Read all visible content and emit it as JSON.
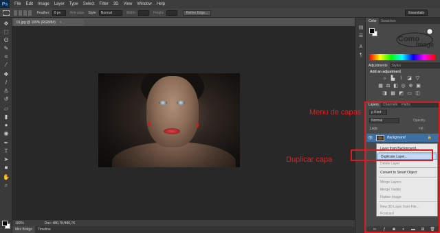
{
  "menubar": {
    "logo": "Ps",
    "items": [
      "File",
      "Edit",
      "Image",
      "Layer",
      "Type",
      "Select",
      "Filter",
      "3D",
      "View",
      "Window",
      "Help"
    ]
  },
  "options_bar": {
    "feather_label": "Feather:",
    "feather_value": "0 px",
    "antialias_label": "Anti-alias",
    "style_label": "Style:",
    "style_value": "Normal",
    "width_label": "Width:",
    "height_label": "Height:",
    "refine_edge_label": "Refine Edge...",
    "workspace_value": "Essentials"
  },
  "document": {
    "tab_title": "01.jpg @ 100% (RGB/8#)",
    "close_glyph": "×",
    "zoom": "100%",
    "doc_size": "Doc: 480,7K/480,7K"
  },
  "bottom_tabs": [
    "Mini Bridge",
    "Timeline"
  ],
  "color_panel": {
    "tabs": [
      "Color",
      "Swatches"
    ]
  },
  "adjustments_panel": {
    "tabs": [
      "Adjustments",
      "Styles"
    ],
    "title": "Add an adjustment"
  },
  "layers_panel": {
    "tabs": [
      "Layers",
      "Channels",
      "Paths"
    ],
    "kind_label": "ρ Kind",
    "blend_mode": "Normal",
    "opacity_label": "Opacity:",
    "lock_label": "Lock:",
    "fill_label": "Fill:",
    "layer_name": "Background"
  },
  "context_menu": {
    "items": [
      {
        "label": "Layer from Background...",
        "state": "normal"
      },
      {
        "label": "Duplicate Layer...",
        "state": "highlight"
      },
      {
        "label": "Delete Layer",
        "state": "disabled"
      },
      {
        "label": "Convert to Smart Object",
        "state": "normal"
      },
      {
        "label": "Merge Layers",
        "state": "disabled"
      },
      {
        "label": "Merge Visible",
        "state": "disabled"
      },
      {
        "label": "Flatten Image",
        "state": "disabled"
      },
      {
        "label": "New 3D Layer from File...",
        "state": "disabled"
      },
      {
        "label": "Postcard",
        "state": "disabled"
      }
    ]
  },
  "annotations": {
    "menu_label": "Menu de capas",
    "duplicate_label": "Duplicar capa",
    "color": "#e02020"
  },
  "icons": {
    "tools": [
      "move-icon",
      "marquee-icon",
      "lasso-icon",
      "quick-select-icon",
      "crop-icon",
      "eyedropper-icon",
      "healing-brush-icon",
      "brush-icon",
      "clone-stamp-icon",
      "history-brush-icon",
      "eraser-icon",
      "gradient-icon",
      "blur-icon",
      "dodge-icon",
      "pen-icon",
      "type-icon",
      "path-select-icon",
      "shape-icon",
      "hand-icon",
      "zoom-icon"
    ]
  },
  "colors": {
    "accent_selection": "#3d6fa3",
    "menu_highlight": "#c6d9f1",
    "annotation_red": "#d61c1c"
  }
}
